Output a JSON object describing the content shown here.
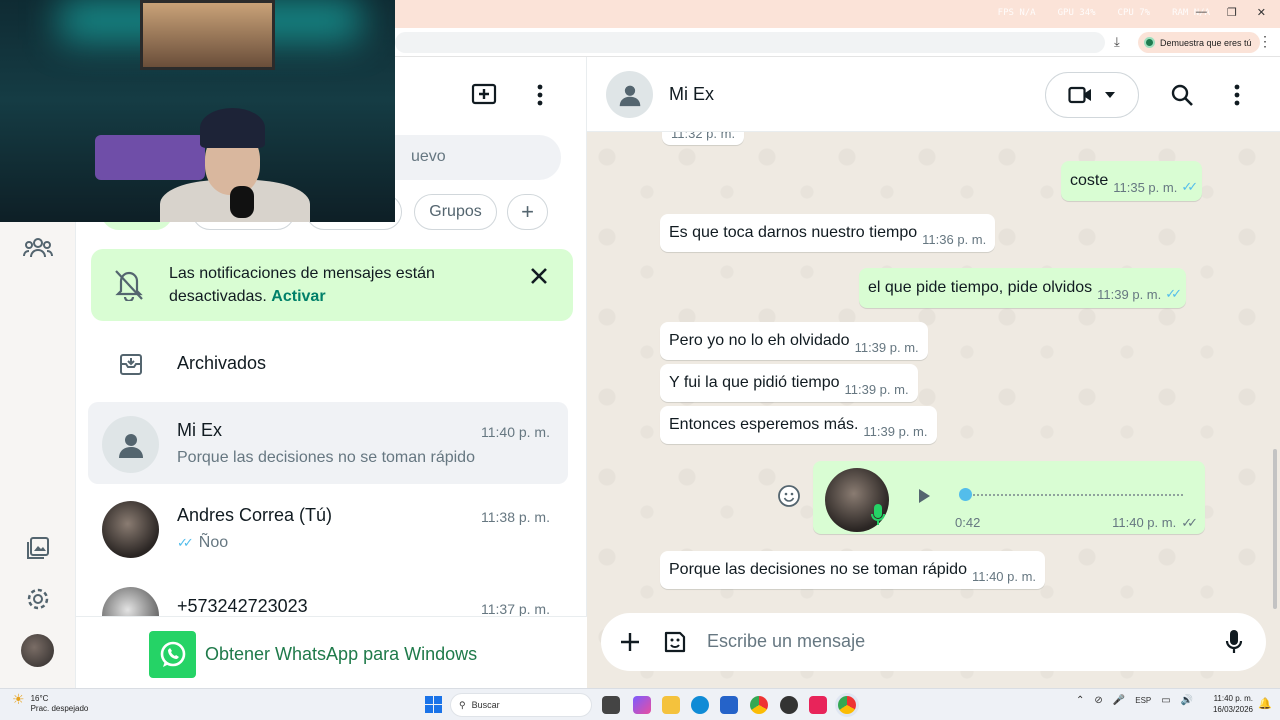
{
  "browser": {
    "stats": [
      "FPS N/A",
      "GPU 34%",
      "CPU 7%",
      "RAM N/A"
    ],
    "profile_label": "Demuestra que eres tú"
  },
  "sidebar": {
    "icons": [
      "communities-icon",
      "media-icon",
      "settings-icon",
      "profile-avatar"
    ]
  },
  "chat_list": {
    "search_placeholder_fragment": "uevo",
    "filters": [
      "",
      "",
      "",
      "Grupos",
      "+"
    ],
    "notification": {
      "text": "Las notificaciones de mensajes están desactivadas.",
      "action": "Activar"
    },
    "archived_label": "Archivados",
    "chats": [
      {
        "name": "Mi Ex",
        "time": "11:40 p. m.",
        "preview": "Porque las decisiones no se toman rápido",
        "selected": true
      },
      {
        "name": "Andres Correa (Tú)",
        "time": "11:38 p. m.",
        "preview": "Ñoo",
        "read_ticks": true
      },
      {
        "name": "+573242723023",
        "time": "11:37 p. m.",
        "preview": ""
      }
    ],
    "get_app_label": "Obtener WhatsApp para Windows"
  },
  "conversation": {
    "contact_name": "Mi Ex",
    "clipped_time": "11:32 p. m.",
    "messages": [
      {
        "dir": "out",
        "text": "coste",
        "time": "11:35 p. m."
      },
      {
        "dir": "in",
        "text": "Es que toca darnos nuestro tiempo",
        "time": "11:36 p. m."
      },
      {
        "dir": "out",
        "text": "el que pide tiempo, pide olvidos",
        "time": "11:39 p. m."
      },
      {
        "dir": "in",
        "text": "Pero yo no lo eh olvidado",
        "time": "11:39 p. m."
      },
      {
        "dir": "in",
        "text": "Y fui la que pidió tiempo",
        "time": "11:39 p. m."
      },
      {
        "dir": "in",
        "text": "Entonces esperemos más.",
        "time": "11:39 p. m."
      },
      {
        "dir": "in",
        "text": "Porque las decisiones no se toman rápido",
        "time": "11:40 p. m."
      }
    ],
    "voice_note": {
      "duration": "0:42",
      "time": "11:40 p. m.",
      "progress": 0
    },
    "composer_placeholder": "Escribe un mensaje"
  },
  "taskbar": {
    "weather_temp": "16°C",
    "weather_desc": "Prac. despejado",
    "search_label": "Buscar",
    "lang": "ESP",
    "time": "11:40 p. m.",
    "date": "16/03/2026"
  },
  "colors": {
    "accent": "#008069",
    "bubble_out": "#d9fdd3",
    "read_ticks": "#53bdeb"
  }
}
